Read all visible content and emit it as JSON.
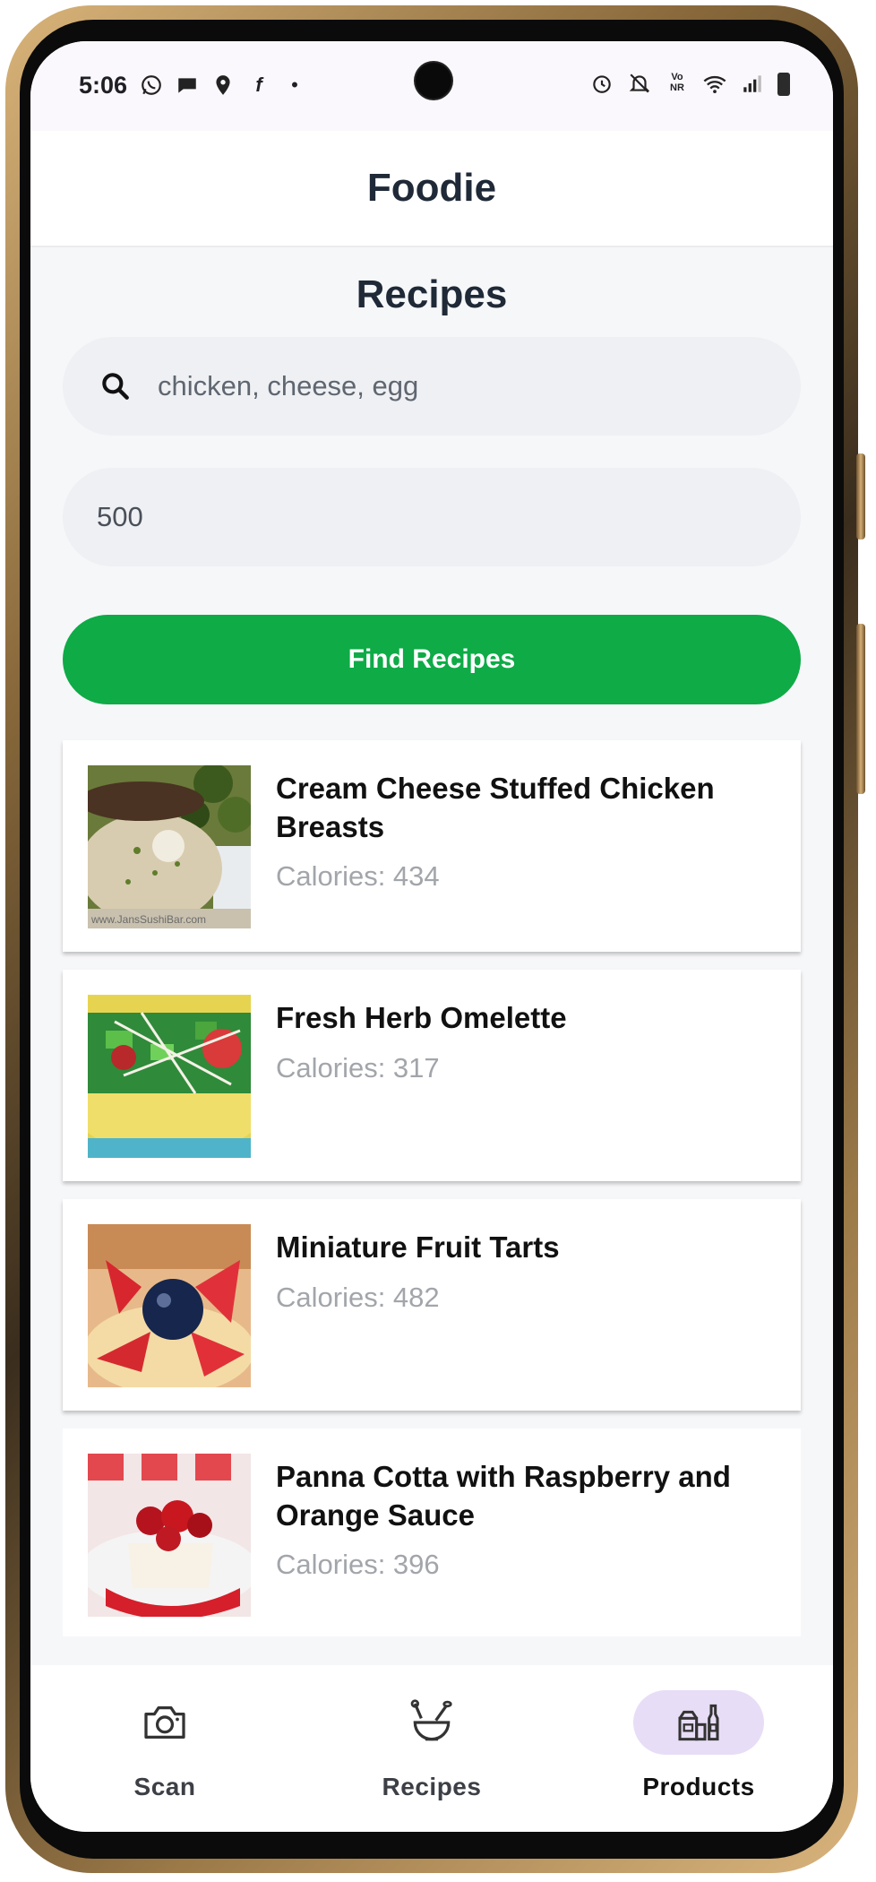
{
  "status_bar": {
    "time": "5:06",
    "left_icons": [
      "whatsapp-icon",
      "chat-icon",
      "location-pin-icon",
      "facebook-icon",
      "dot-icon"
    ],
    "right_icons": [
      "alarm-icon",
      "bell-off-icon",
      "vonr-icon",
      "wifi-icon",
      "signal-icon",
      "battery-icon"
    ],
    "vonr_label": "Vo\nNR"
  },
  "app": {
    "title": "Foodie"
  },
  "page": {
    "title": "Recipes",
    "search": {
      "value": "chicken, cheese, egg"
    },
    "calories": {
      "value": "500"
    },
    "find_button": "Find Recipes"
  },
  "recipes": [
    {
      "name": "Cream Cheese Stuffed Chicken Breasts",
      "calories": "Calories: 434",
      "watermark": "www.JansSushiBar.com"
    },
    {
      "name": "Fresh Herb Omelette",
      "calories": "Calories: 317"
    },
    {
      "name": "Miniature Fruit Tarts",
      "calories": "Calories: 482"
    },
    {
      "name": "Panna Cotta with Raspberry and Orange Sauce",
      "calories": "Calories: 396"
    }
  ],
  "nav": {
    "items": [
      {
        "label": "Scan",
        "icon": "camera-icon",
        "active": false
      },
      {
        "label": "Recipes",
        "icon": "mixing-bowl-icon",
        "active": false
      },
      {
        "label": "Products",
        "icon": "grocery-products-icon",
        "active": true
      }
    ]
  },
  "colors": {
    "accent_green": "#0eab47",
    "active_nav_bg": "#e8ddf6",
    "title_text": "#1f2937",
    "calorie_text": "#a2a5aa"
  }
}
